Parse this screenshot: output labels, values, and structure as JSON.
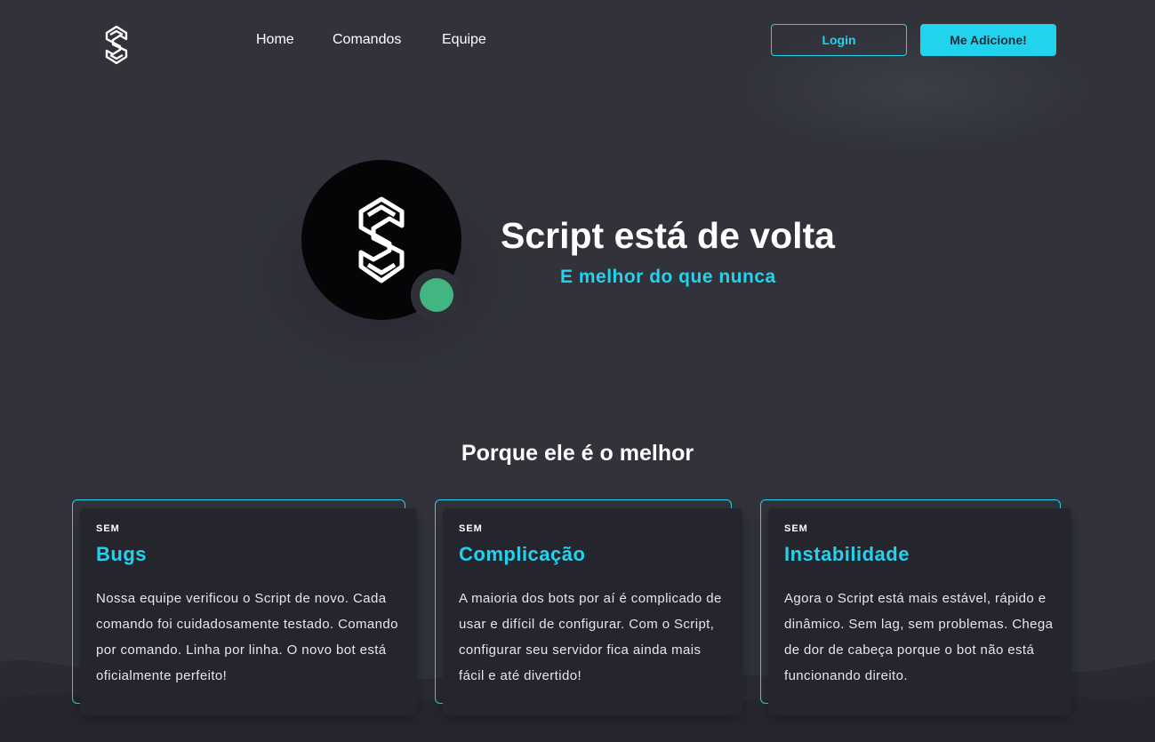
{
  "navbar": {
    "links": [
      "Home",
      "Comandos",
      "Equipe"
    ],
    "login_label": "Login",
    "add_label": "Me Adicione!"
  },
  "hero": {
    "title": "Script está de volta",
    "subtitle": "E melhor do que nunca",
    "status": "online",
    "status_color": "#43b581"
  },
  "features": {
    "title": "Porque ele é o melhor",
    "cards": [
      {
        "kicker": "SEM",
        "title": "Bugs",
        "text": "Nossa equipe verificou o Script de novo. Cada comando foi cuidadosamente testado. Comando por comando. Linha por linha. O novo bot está oficialmente perfeito!"
      },
      {
        "kicker": "SEM",
        "title": "Complicação",
        "text": "A maioria dos bots por aí é complicado de usar e difícil de configurar. Com o Script, configurar seu servidor fica ainda mais fácil e até divertido!"
      },
      {
        "kicker": "SEM",
        "title": "Instabilidade",
        "text": "Agora o Script está mais estável, rápido e dinâmico. Sem lag, sem problemas. Chega de dor de cabeça porque o bot não está funcionando direito."
      }
    ]
  },
  "colors": {
    "accent": "#22d3ee",
    "background": "#31323a",
    "card": "#24252d"
  }
}
